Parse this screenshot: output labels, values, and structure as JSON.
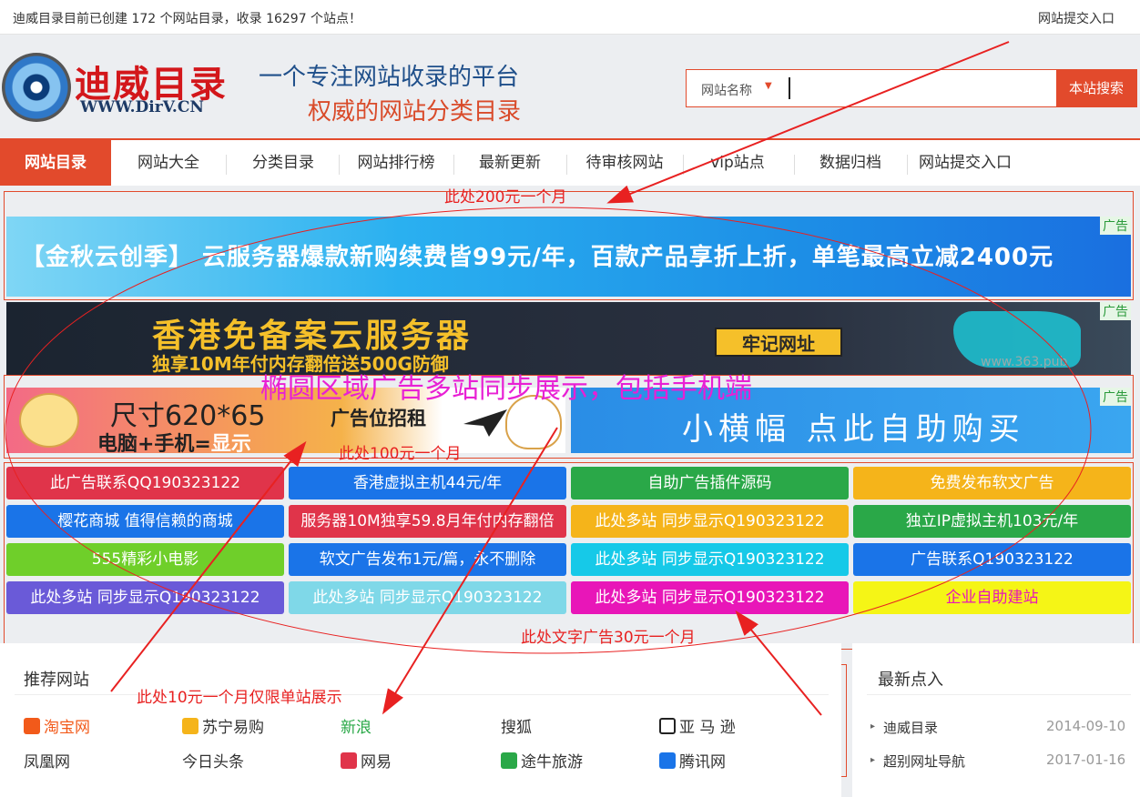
{
  "topbar": {
    "notice": "迪威目录目前已创建 172 个网站目录，收录 16297 个站点！",
    "submit_link": "网站提交入口"
  },
  "header": {
    "logo_cn": "迪威目录",
    "logo_en": "WWW.DirV.CN",
    "slogan1": "一个专注网站收录的平台",
    "slogan2": "权威的网站分类目录"
  },
  "search": {
    "select_label": "网站名称",
    "button": "本站搜索"
  },
  "nav": {
    "items": [
      "网站目录",
      "网站大全",
      "分类目录",
      "网站排行榜",
      "最新更新",
      "待审核网站",
      "vip站点",
      "数据归档",
      "网站提交入口"
    ]
  },
  "ads": {
    "tag": "广告",
    "banner1": "【金秋云创季】 云服务器爆款新购续费皆99元/年，百款产品享折上折，单笔最高立减2400元",
    "banner2_title": "香港免备案云服务器",
    "banner2_sub": "独享10M年付内存翻倍送500G防御",
    "banner2_btn": "牢记网址",
    "banner2_url": "www.363.pub",
    "banner3_size": "尺寸620*65",
    "banner3_device_a": "电脑+手机=",
    "banner3_device_b": "显示",
    "banner3_recruit": "广告位招租",
    "banner4": "小横幅 点此自助购买"
  },
  "text_ads": [
    {
      "label": "此广告联系QQ190323122",
      "color": "#e0344a"
    },
    {
      "label": "香港虚拟主机44元/年",
      "color": "#1a74e8"
    },
    {
      "label": "自助广告插件源码",
      "color": "#2aa848"
    },
    {
      "label": "免费发布软文广告",
      "color": "#f5b41a"
    },
    {
      "label": "樱花商城 值得信赖的商城",
      "color": "#1a74e8"
    },
    {
      "label": "服务器10M独享59.8月年付内存翻倍",
      "color": "#e0344a"
    },
    {
      "label": "此处多站 同步显示Q190323122",
      "color": "#f5b41a"
    },
    {
      "label": "独立IP虚拟主机103元/年",
      "color": "#2aa848"
    },
    {
      "label": "555精彩小电影",
      "color": "#6fcf2a"
    },
    {
      "label": "软文广告发布1元/篇，永不删除",
      "color": "#1a74e8"
    },
    {
      "label": "此处多站 同步显示Q190323122",
      "color": "#16c9e8"
    },
    {
      "label": "广告联系Q190323122",
      "color": "#1a74e8"
    },
    {
      "label": "此处多站 同步显示Q190323122",
      "color": "#6a5ad8"
    },
    {
      "label": "此处多站 同步显示Q190323122",
      "color": "#7fd8e8"
    },
    {
      "label": "此处多站 同步显示Q190323122",
      "color": "#e816b8"
    },
    {
      "label": "企业自助建站",
      "color": "#f5f516",
      "text_color": "#e816b8"
    }
  ],
  "recommended": {
    "title": "推荐网站",
    "sites": [
      {
        "name": "淘宝网",
        "color": "#f25a1a",
        "icon": "taobao-icon"
      },
      {
        "name": "苏宁易购",
        "color": "#333333",
        "icon": "suning-icon"
      },
      {
        "name": "新浪",
        "color": "#2aa848",
        "icon": ""
      },
      {
        "name": "搜狐",
        "color": "#333333",
        "icon": ""
      },
      {
        "name": "亚 马 逊",
        "color": "#333333",
        "icon": "amazon-icon"
      },
      {
        "name": "凤凰网",
        "color": "#333333",
        "icon": ""
      },
      {
        "name": "今日头条",
        "color": "#333333",
        "icon": ""
      },
      {
        "name": "网易",
        "color": "#333333",
        "icon": "netease-icon"
      },
      {
        "name": "途牛旅游",
        "color": "#333333",
        "icon": "tuniu-icon"
      },
      {
        "name": "腾讯网",
        "color": "#333333",
        "icon": "tencent-icon"
      }
    ]
  },
  "latest": {
    "title": "最新点入",
    "items": [
      {
        "name": "迪威目录",
        "date": "2014-09-10"
      },
      {
        "name": "超别网址导航",
        "date": "2017-01-16"
      }
    ]
  },
  "annotations": {
    "a200": "此处200元一个月",
    "ellipse": "椭圆区域广告多站同步展示，包括手机端",
    "a100": "此处100元一个月",
    "a30": "此处文字广告30元一个月",
    "a10": "此处10元一个月仅限单站展示"
  }
}
